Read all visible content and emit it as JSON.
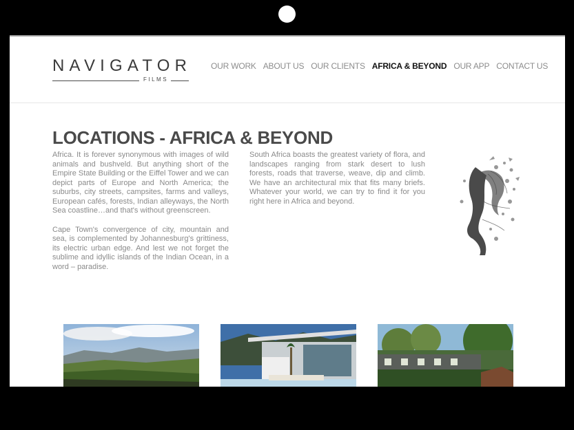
{
  "logo": {
    "main": "NAVIGATOR",
    "sub": "FILMS"
  },
  "nav": [
    {
      "label": "OUR WORK",
      "active": false
    },
    {
      "label": "ABOUT US",
      "active": false
    },
    {
      "label": "OUR CLIENTS",
      "active": false
    },
    {
      "label": "AFRICA & BEYOND",
      "active": true
    },
    {
      "label": "OUR APP",
      "active": false
    },
    {
      "label": "CONTACT US",
      "active": false
    }
  ],
  "page": {
    "title": "LOCATIONS - AFRICA & BEYOND",
    "col1_p1": "Africa. It is forever synonymous with images of wild animals and bushveld. But anything short of the Empire State Building or the Eiffel Tower and we can depict parts of Europe and North America; the suburbs, city streets, campsites, farms and valleys, European cafés, forests, Indian alleyways, the North Sea coastline…and that's without greenscreen.",
    "col1_p2": "Cape Town's convergence of city, mountain and sea, is complemented by Johannesburg's grittiness, its electric urban edge. And lest we not forget the sublime and idyllic islands of the Indian Ocean, in a word – paradise.",
    "col2_p1": "South Africa boasts the greatest variety of flora, and landscapes ranging from stark desert to lush forests, roads that traverse, weave, dip and climb. We have an architectural mix that fits many briefs. Whatever your world, we can try to find it for you right here in Africa and beyond."
  },
  "images": [
    {
      "name": "vineyard-landscape-photo"
    },
    {
      "name": "modern-house-pool-photo"
    },
    {
      "name": "colonial-house-garden-photo"
    }
  ]
}
